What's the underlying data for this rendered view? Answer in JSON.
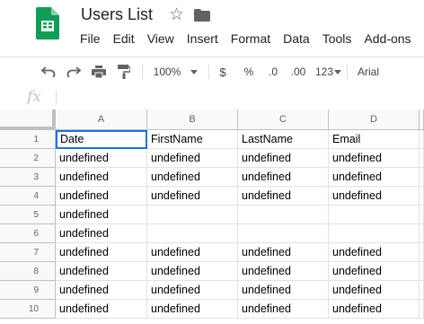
{
  "document": {
    "title": "Users List"
  },
  "menu": [
    "File",
    "Edit",
    "View",
    "Insert",
    "Format",
    "Data",
    "Tools",
    "Add-ons"
  ],
  "toolbar": {
    "zoom": "100%",
    "currency": "$",
    "percent": "%",
    "decrease_decimal": ".0",
    "increase_decimal": ".00",
    "more_formats": "123",
    "font": "Arial"
  },
  "formula_bar": {
    "fx_label": "fx",
    "value": ""
  },
  "columns": [
    "A",
    "B",
    "C",
    "D"
  ],
  "rows": [
    {
      "num": "1",
      "cells": [
        "Date",
        "FirstName",
        "LastName",
        "Email"
      ]
    },
    {
      "num": "2",
      "cells": [
        "undefined",
        "undefined",
        "undefined",
        "undefined"
      ]
    },
    {
      "num": "3",
      "cells": [
        "undefined",
        "undefined",
        "undefined",
        "undefined"
      ]
    },
    {
      "num": "4",
      "cells": [
        "undefined",
        "undefined",
        "undefined",
        "undefined"
      ]
    },
    {
      "num": "5",
      "cells": [
        "undefined",
        "",
        "",
        ""
      ]
    },
    {
      "num": "6",
      "cells": [
        "undefined",
        "",
        "",
        ""
      ]
    },
    {
      "num": "7",
      "cells": [
        "undefined",
        "undefined",
        "undefined",
        "undefined"
      ]
    },
    {
      "num": "8",
      "cells": [
        "undefined",
        "undefined",
        "undefined",
        "undefined"
      ]
    },
    {
      "num": "9",
      "cells": [
        "undefined",
        "undefined",
        "undefined",
        "undefined"
      ]
    },
    {
      "num": "10",
      "cells": [
        "undefined",
        "undefined",
        "undefined",
        "undefined"
      ]
    }
  ],
  "selected_cell": "A1",
  "colors": {
    "sheets_green": "#0f9d58",
    "selection": "#1a73e8",
    "grid_line": "#e2e2e3",
    "header_bg": "#f8f9fa"
  }
}
